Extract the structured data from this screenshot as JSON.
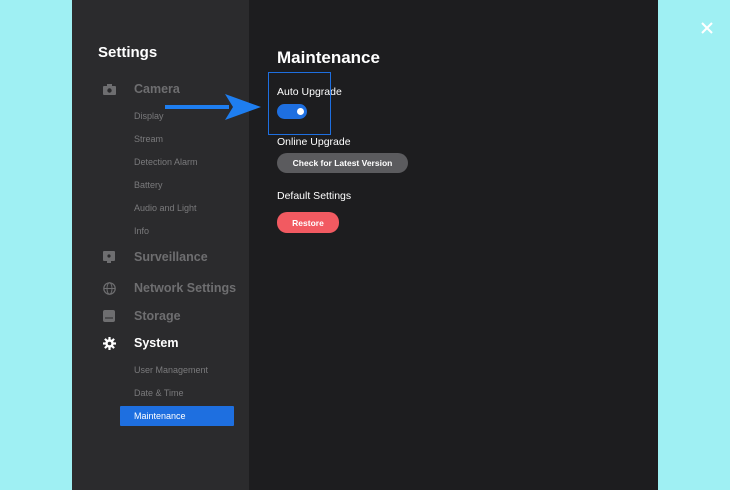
{
  "sidebar": {
    "title": "Settings",
    "sections": [
      {
        "label": "Camera",
        "icon": "camera-icon"
      },
      {
        "label": "Surveillance",
        "icon": "surveillance-icon"
      },
      {
        "label": "Network Settings",
        "icon": "globe-icon"
      },
      {
        "label": "Storage",
        "icon": "storage-icon"
      },
      {
        "label": "System",
        "icon": "gear-icon"
      }
    ],
    "camera_items": [
      "Display",
      "Stream",
      "Detection Alarm",
      "Battery",
      "Audio and Light",
      "Info"
    ],
    "system_items": [
      "User Management",
      "Date & Time",
      "Maintenance"
    ],
    "active_item": "Maintenance"
  },
  "main": {
    "title": "Maintenance",
    "auto_upgrade": {
      "label": "Auto Upgrade",
      "enabled": true
    },
    "online_upgrade": {
      "label": "Online Upgrade",
      "button": "Check for Latest Version"
    },
    "default_settings": {
      "label": "Default Settings",
      "button": "Restore"
    }
  },
  "colors": {
    "accent": "#1e6fe0",
    "restore": "#f25a61",
    "background": "#9ff0f3"
  },
  "icons": {
    "close": "close-icon",
    "annotation": "arrow-right-icon"
  }
}
